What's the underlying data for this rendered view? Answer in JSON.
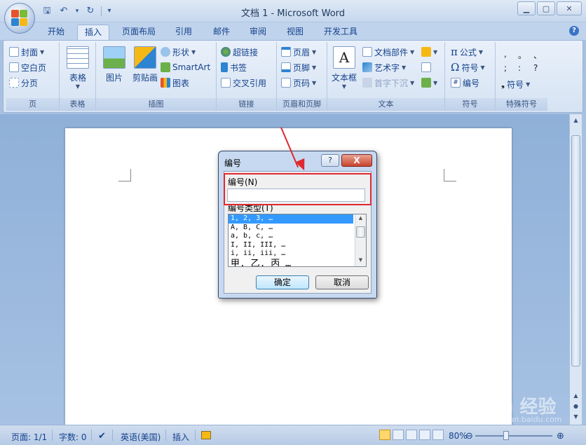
{
  "window": {
    "title": "文档 1 - Microsoft Word",
    "controls": {
      "minimize": "▁",
      "maximize": "▢",
      "close": "✕"
    }
  },
  "qat": {
    "save": "🖫",
    "undo": "↶",
    "undo_dd": "▾",
    "redo": "↻",
    "customize": "▾"
  },
  "tabs": [
    "开始",
    "插入",
    "页面布局",
    "引用",
    "邮件",
    "审阅",
    "视图",
    "开发工具"
  ],
  "active_tab": "插入",
  "help": "?",
  "ribbon": {
    "pages": {
      "label": "页",
      "cover": "封面",
      "blank": "空白页",
      "break": "分页"
    },
    "tables": {
      "label": "表格",
      "table": "表格"
    },
    "illustrations": {
      "label": "插图",
      "picture": "图片",
      "clipart": "剪贴画",
      "shapes": "形状",
      "smartart": "SmartArt",
      "chart": "图表"
    },
    "links": {
      "label": "链接",
      "hyperlink": "超链接",
      "bookmark": "书签",
      "crossref": "交叉引用"
    },
    "header_footer": {
      "label": "页眉和页脚",
      "header": "页眉",
      "footer": "页脚",
      "pagenum": "页码"
    },
    "text": {
      "label": "文本",
      "textbox": "文本框",
      "quickparts": "文档部件",
      "wordart": "艺术字",
      "dropcap": "首字下沉"
    },
    "symbols": {
      "label": "符号",
      "equation": "公式",
      "symbol": "符号",
      "number": "编号"
    },
    "special": {
      "label": "特殊符号",
      "chars": [
        ",",
        "。",
        "、",
        ";",
        ":",
        "?"
      ],
      "symbol": "符号"
    }
  },
  "dialog": {
    "title": "编号",
    "help": "?",
    "close": "X",
    "number_label": "编号(N)",
    "number_value": "",
    "type_label": "编号类型(T)",
    "types": [
      "1, 2, 3, …",
      "A, B, C, …",
      "a, b, c, …",
      "I, II, III, …",
      "i, ii, iii, …",
      "甲, 乙, 丙 …"
    ],
    "selected_type": 0,
    "ok": "确定",
    "cancel": "取消"
  },
  "statusbar": {
    "page": "页面: 1/1",
    "words": "字数: 0",
    "language": "英语(美国)",
    "mode": "插入",
    "zoom": "80%",
    "zoom_level": 0.8
  },
  "watermark": {
    "brand": "Bai du 经验",
    "url": "jingyan.baidu.com"
  },
  "colors": {
    "highlight": "#e0282e",
    "accent": "#3399ff"
  }
}
